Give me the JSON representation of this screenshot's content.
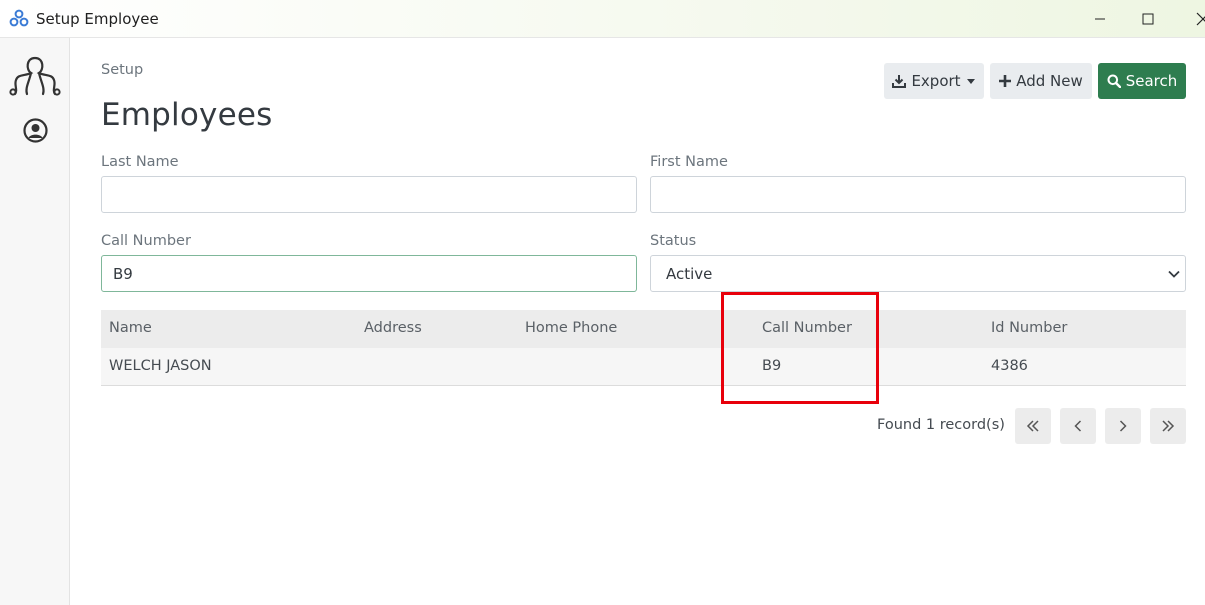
{
  "window": {
    "title": "Setup Employee"
  },
  "rail": {
    "items": [
      {
        "icon": "app-logo-icon"
      },
      {
        "icon": "user-circle-icon"
      }
    ]
  },
  "page": {
    "breadcrumb": "Setup",
    "title": "Employees"
  },
  "toolbar": {
    "export_label": "Export",
    "add_new_label": "Add New",
    "search_label": "Search"
  },
  "filters": {
    "last_name": {
      "label": "Last Name",
      "value": ""
    },
    "first_name": {
      "label": "First Name",
      "value": ""
    },
    "call_number": {
      "label": "Call Number",
      "value": "B9"
    },
    "status": {
      "label": "Status",
      "value": "Active"
    }
  },
  "table": {
    "columns": [
      "Name",
      "Address",
      "Home Phone",
      "Call Number",
      "Id Number"
    ],
    "rows": [
      [
        "WELCH JASON",
        "",
        "",
        "B9",
        "4386"
      ]
    ]
  },
  "pagination": {
    "found_text": "Found 1 record(s)"
  },
  "colors": {
    "accent": "#2e7d4f",
    "highlight": "#e8000b"
  }
}
